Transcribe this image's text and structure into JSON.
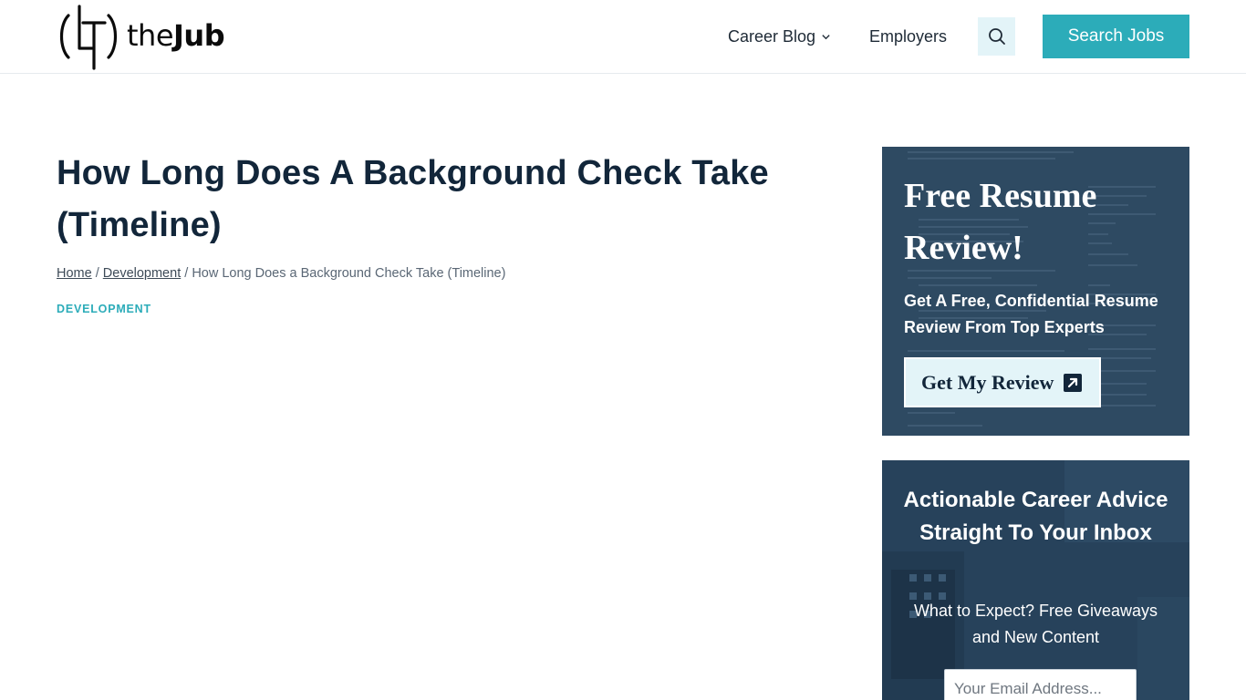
{
  "header": {
    "logo_the": "the",
    "logo_jub": "Jub",
    "nav": {
      "career_blog": "Career Blog",
      "employers": "Employers"
    },
    "search_jobs": "Search Jobs"
  },
  "article": {
    "title": "How Long Does A Background Check Take (Timeline)",
    "breadcrumb": {
      "home": "Home",
      "sep1": " / ",
      "development": "Development",
      "sep2": " / ",
      "current": "How Long Does a Background Check Take (Timeline)"
    },
    "category": "DEVELOPMENT"
  },
  "promo": {
    "title": "Free Resume Review!",
    "subtitle": "Get A Free, Confidential Resume Review From Top Experts",
    "button": "Get My Review",
    "button_icon": "external-link-icon"
  },
  "newsletter": {
    "title": "Actionable Career Advice Straight To Your Inbox",
    "subtitle": "What to Expect? Free Giveaways and New Content",
    "email_placeholder": "Your Email Address..."
  },
  "colors": {
    "accent": "#2cacb9",
    "accent_light": "#e3f4f8",
    "heading": "#12263a",
    "widget_bg": "#2e4a62"
  }
}
